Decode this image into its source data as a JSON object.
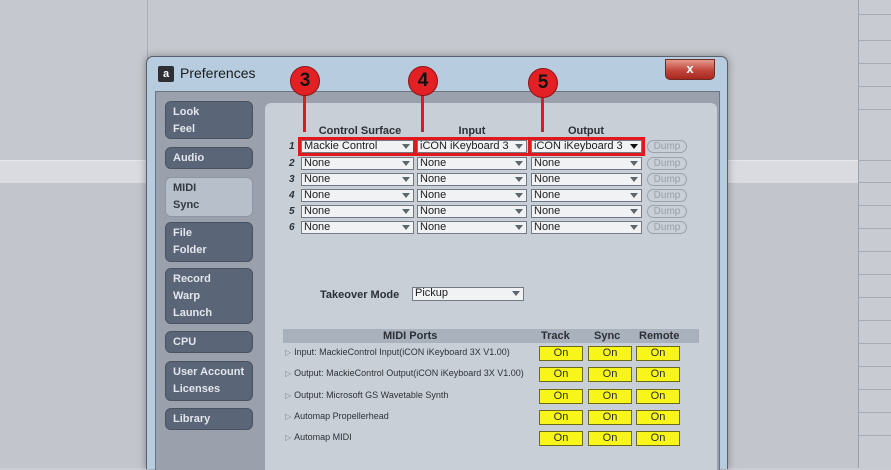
{
  "window": {
    "title": "Preferences",
    "close_label": "x"
  },
  "tabs": [
    {
      "lines": [
        "Look",
        "Feel"
      ]
    },
    {
      "lines": [
        "Audio"
      ]
    },
    {
      "lines": [
        "MIDI",
        "Sync"
      ]
    },
    {
      "lines": [
        "File",
        "Folder"
      ]
    },
    {
      "lines": [
        "Record",
        "Warp",
        "Launch"
      ]
    },
    {
      "lines": [
        "CPU"
      ]
    },
    {
      "lines": [
        "User Account",
        "Licenses"
      ]
    },
    {
      "lines": [
        "Library"
      ]
    }
  ],
  "active_tab": "MIDI Sync",
  "surfaces": {
    "headers": {
      "control_surface": "Control Surface",
      "input": "Input",
      "output": "Output"
    },
    "dump_label": "Dump",
    "rows": [
      {
        "num": "1",
        "surface": "Mackie Control",
        "input": "iCON iKeyboard 3",
        "output": "iCON iKeyboard 3"
      },
      {
        "num": "2",
        "surface": "None",
        "input": "None",
        "output": "None"
      },
      {
        "num": "3",
        "surface": "None",
        "input": "None",
        "output": "None"
      },
      {
        "num": "4",
        "surface": "None",
        "input": "None",
        "output": "None"
      },
      {
        "num": "5",
        "surface": "None",
        "input": "None",
        "output": "None"
      },
      {
        "num": "6",
        "surface": "None",
        "input": "None",
        "output": "None"
      }
    ]
  },
  "callouts": {
    "surface": "3",
    "input": "4",
    "output": "5"
  },
  "takeover": {
    "label": "Takeover Mode",
    "value": "Pickup"
  },
  "midi_ports": {
    "headers": {
      "name": "MIDI Ports",
      "track": "Track",
      "sync": "Sync",
      "remote": "Remote"
    },
    "rows": [
      {
        "name": "Input:   MackieControl Input(iCON iKeyboard 3X V1.00)",
        "track": "On",
        "sync": "On",
        "remote": "On"
      },
      {
        "name": "Output: MackieControl Output(iCON iKeyboard 3X V1.00)",
        "track": "On",
        "sync": "On",
        "remote": "On"
      },
      {
        "name": "Output: Microsoft GS Wavetable Synth",
        "track": "On",
        "sync": "On",
        "remote": "On"
      },
      {
        "name": "Automap Propellerhead",
        "track": "On",
        "sync": "On",
        "remote": "On"
      },
      {
        "name": "Automap MIDI",
        "track": "On",
        "sync": "On",
        "remote": "On"
      }
    ]
  },
  "colors": {
    "callout": "#e1181c",
    "on_button": "#f7f51a",
    "active_tab": "#b7bfcb"
  }
}
